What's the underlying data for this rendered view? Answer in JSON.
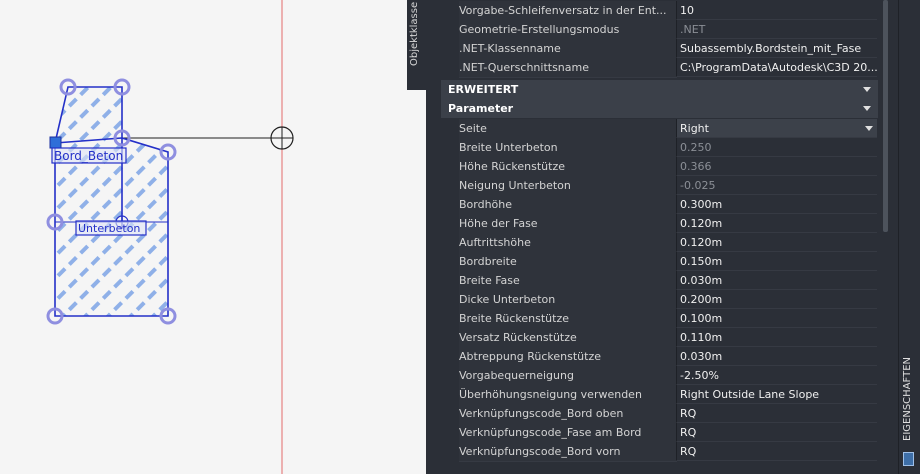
{
  "side_tab": {
    "label": "Objektklasse"
  },
  "right_strip": {
    "label": "EIGENSCHAFTEN",
    "icon": "properties-icon"
  },
  "drawing": {
    "labels": {
      "bord_beton": "Bord_Beton",
      "unterbeton": "Unterbeton"
    }
  },
  "top_rows": [
    {
      "name": "Vorgabe-Schleifenversatz in der Ent...",
      "value": "10",
      "readonly": false
    },
    {
      "name": "Geometrie-Erstellungsmodus",
      "value": ".NET",
      "readonly": true
    },
    {
      "name": ".NET-Klassenname",
      "value": "Subassembly.Bordstein_mit_Fase",
      "readonly": false
    },
    {
      "name": ".NET-Querschnittsname",
      "value": "C:\\ProgramData\\Autodesk\\C3D 20...",
      "readonly": false
    }
  ],
  "sections": {
    "erweitert": "ERWEITERT",
    "parameter": "Parameter"
  },
  "seite": {
    "name": "Seite",
    "value": "Right"
  },
  "param_rows": [
    {
      "name": "Breite Unterbeton",
      "value": "0.250",
      "readonly": true
    },
    {
      "name": "Höhe Rückenstütze",
      "value": "0.366",
      "readonly": true
    },
    {
      "name": "Neigung Unterbeton",
      "value": "-0.025",
      "readonly": true
    },
    {
      "name": "Bordhöhe",
      "value": "0.300m",
      "readonly": false
    },
    {
      "name": "Höhe der Fase",
      "value": "0.120m",
      "readonly": false
    },
    {
      "name": "Auftrittshöhe",
      "value": "0.120m",
      "readonly": false
    },
    {
      "name": "Bordbreite",
      "value": "0.150m",
      "readonly": false
    },
    {
      "name": "Breite Fase",
      "value": "0.030m",
      "readonly": false
    },
    {
      "name": "Dicke Unterbeton",
      "value": "0.200m",
      "readonly": false
    },
    {
      "name": "Breite Rückenstütze",
      "value": "0.100m",
      "readonly": false
    },
    {
      "name": "Versatz Rückenstütze",
      "value": "0.110m",
      "readonly": false
    },
    {
      "name": "Abtreppung Rückenstütze",
      "value": "0.030m",
      "readonly": false
    },
    {
      "name": "Vorgabequerneigung",
      "value": "-2.50%",
      "readonly": false
    },
    {
      "name": "Überhöhungsneigung verwenden",
      "value": "Right Outside Lane Slope",
      "readonly": false
    },
    {
      "name": "Verknüpfungscode_Bord oben",
      "value": "RQ",
      "readonly": false
    },
    {
      "name": "Verknüpfungscode_Fase am Bord",
      "value": "RQ",
      "readonly": false
    },
    {
      "name": "Verknüpfungscode_Bord vorn",
      "value": "RQ",
      "readonly": false
    }
  ],
  "colors": {
    "panel_bg": "#2b2f37",
    "grip": "#3a5bd8",
    "axis_line": "#e36b6b"
  }
}
